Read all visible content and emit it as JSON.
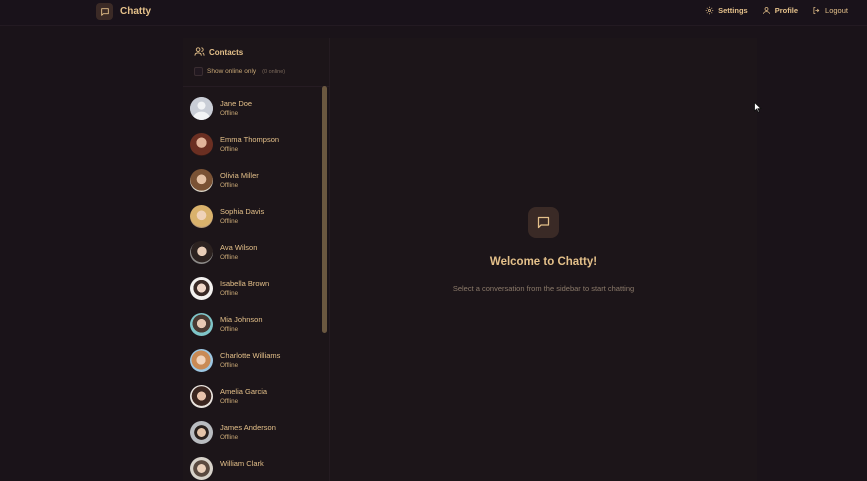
{
  "app": {
    "name": "Chatty"
  },
  "nav": {
    "settings": "Settings",
    "profile": "Profile",
    "logout": "Logout"
  },
  "sidebar": {
    "title": "Contacts",
    "filter_label": "Show online only",
    "online_count": "(0 online)",
    "contacts": [
      {
        "name": "Jane Doe",
        "status": "Offline",
        "avatar": "default-avatar"
      },
      {
        "name": "Emma Thompson",
        "status": "Offline",
        "avatar": "photo"
      },
      {
        "name": "Olivia Miller",
        "status": "Offline",
        "avatar": "photo"
      },
      {
        "name": "Sophia Davis",
        "status": "Offline",
        "avatar": "photo"
      },
      {
        "name": "Ava Wilson",
        "status": "Offline",
        "avatar": "photo"
      },
      {
        "name": "Isabella Brown",
        "status": "Offline",
        "avatar": "photo"
      },
      {
        "name": "Mia Johnson",
        "status": "Offline",
        "avatar": "photo"
      },
      {
        "name": "Charlotte Williams",
        "status": "Offline",
        "avatar": "photo"
      },
      {
        "name": "Amelia Garcia",
        "status": "Offline",
        "avatar": "photo"
      },
      {
        "name": "James Anderson",
        "status": "Offline",
        "avatar": "photo"
      },
      {
        "name": "William Clark",
        "status": "",
        "avatar": "photo"
      }
    ]
  },
  "welcome": {
    "title": "Welcome to Chatty!",
    "subtitle": "Select a conversation from the sidebar to start chatting"
  },
  "colors": {
    "background": "#1a1319",
    "accent": "#e4c08a",
    "muted": "#8b7a6a",
    "icon_tile": "#3a2a26"
  }
}
